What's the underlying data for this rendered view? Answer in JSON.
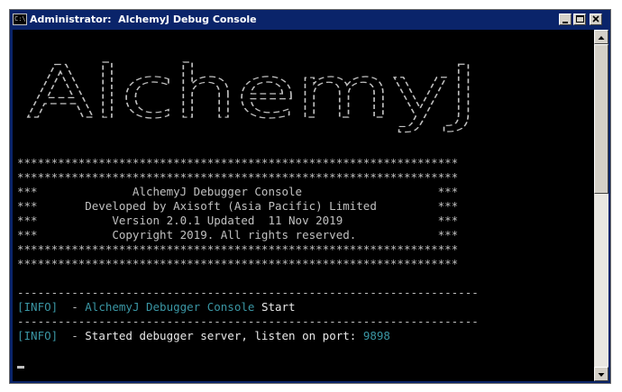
{
  "window": {
    "title": "Administrator:  AlchemyJ Debug Console",
    "icon_label": "C:\\"
  },
  "banner": {
    "text": "AlchemyJ"
  },
  "console": {
    "stars": "*****************************************************************",
    "box_lines": [
      "***              AlchemyJ Debugger Console                    ***",
      "***       Developed by Axisoft (Asia Pacific) Limited         ***",
      "***           Version 2.0.1 Updated  11 Nov 2019              ***",
      "***           Copyright 2019. All rights reserved.            ***"
    ],
    "divider": "--------------------------------------------------------------------",
    "log1": {
      "tag": "[INFO]",
      "sep": "  - ",
      "highlight": "AlchemyJ Debugger Console",
      "rest": " Start"
    },
    "log2": {
      "tag": "[INFO]",
      "sep": "  - ",
      "text": "Started debugger server, listen on port: ",
      "port": "9898"
    }
  },
  "colors": {
    "console_bg": "#000000",
    "text": "#c0c0c0",
    "accent_cyan": "#3a96a4",
    "titlebar": "#0a246a"
  }
}
